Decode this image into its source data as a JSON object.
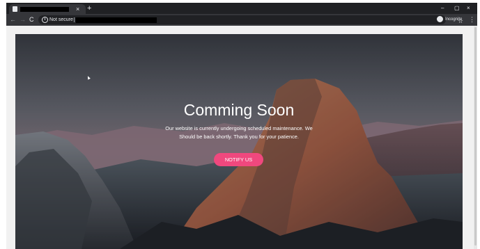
{
  "browser": {
    "tab_close_glyph": "×",
    "new_tab_glyph": "+",
    "window_controls": {
      "minimize": "–",
      "maximize": "▢",
      "close": "×"
    },
    "nav": {
      "back": "←",
      "forward": "→",
      "reload": "C"
    },
    "security_label": "Not secure",
    "bookmark_glyph": "☆",
    "profile_label": "Incognito",
    "menu_glyph": "⋮",
    "icons": {
      "security": "info-icon",
      "profile": "incognito-icon",
      "tab": "page-favicon-icon"
    }
  },
  "page": {
    "title": "Comming Soon",
    "message": "Our website is currently undergoing scheduled maintenance. We Should be back shortly. Thank you for your patience.",
    "notify_button": "NOTIFY US",
    "colors": {
      "accent": "#f0487e",
      "chrome_dark": "#202124",
      "chrome_toolbar": "#35363a"
    }
  }
}
